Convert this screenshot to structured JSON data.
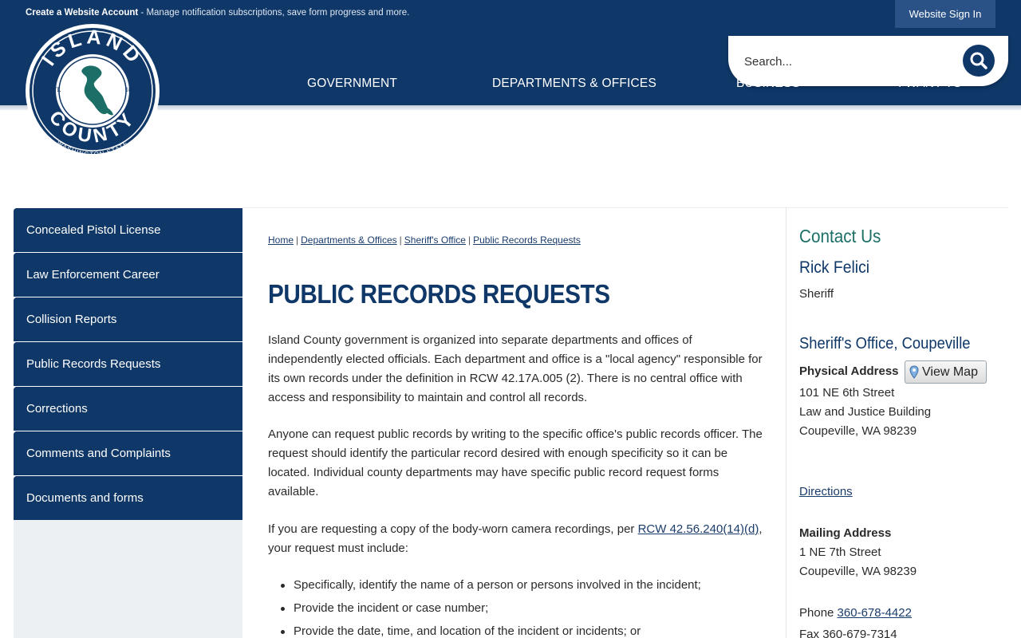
{
  "topbar": {
    "account_link": "Create a Website Account",
    "account_desc": " - Manage notification subscriptions, save form progress and more.",
    "signin_label": "Website Sign In"
  },
  "search": {
    "placeholder": "Search..."
  },
  "nav": {
    "items": [
      {
        "label": "GOVERNMENT"
      },
      {
        "label": "DEPARTMENTS & OFFICES"
      },
      {
        "label": "BUSINESS"
      },
      {
        "label": "I WANT TO"
      }
    ]
  },
  "logo": {
    "line1": "ISLAND",
    "line2": "COUNTY",
    "est": "EST.",
    "year": "1853",
    "state": "WASHINGTON STATE"
  },
  "sidebar": {
    "items": [
      {
        "label": "Concealed Pistol License"
      },
      {
        "label": "Law Enforcement Career"
      },
      {
        "label": "Collision Reports"
      },
      {
        "label": "Public Records Requests"
      },
      {
        "label": "Corrections"
      },
      {
        "label": "Comments and Complaints"
      },
      {
        "label": "Documents and forms"
      }
    ]
  },
  "breadcrumb": {
    "items": [
      {
        "label": "Home"
      },
      {
        "label": "Departments & Offices"
      },
      {
        "label": "Sheriff's Office"
      },
      {
        "label": "Public Records Requests"
      }
    ],
    "separator": "|"
  },
  "page": {
    "title": "PUBLIC RECORDS REQUESTS",
    "para1": "Island County government is organized into separate departments and offices of independently elected officials. Each department and office is a \"local agency\" responsible for its own records under the definition in RCW 42.17A.005 (2). There is no central office with access and responsibility to maintain and control all records.",
    "para2": "Anyone can request public records by writing to the specific office's public records officer. The request should identify the particular record desired with enough specificity so it can be located. Individual county departments may have specific public record request forms available.",
    "para3_before": "If you are requesting a copy of the body-worn camera recordings, per ",
    "para3_link": "RCW 42.56.240(14)(d)",
    "para3_after": ", your request must include:",
    "bullets": [
      "Specifically, identify the name of a person or persons involved in the incident;",
      "Provide the incident or case number;",
      "Provide the date, time, and location of the incident or incidents; or"
    ]
  },
  "contact": {
    "heading": "Contact Us",
    "name": "Rick Felici",
    "title": "Sheriff",
    "office": "Sheriff's Office, Coupeville",
    "physical_label": "Physical Address",
    "map_button": "View Map",
    "physical_lines": [
      "101 NE 6th Street",
      "Law and Justice Building",
      "Coupeville, WA 98239"
    ],
    "directions": "Directions",
    "mailing_label": "Mailing Address",
    "mailing_lines": [
      "1 NE 7th Street",
      "Coupeville, WA 98239"
    ],
    "phone_label": "Phone ",
    "phone": "360-678-4422",
    "fax_label": "Fax ",
    "fax": "360-679-7314"
  },
  "colors": {
    "brand_navy": "#0f3768",
    "accent_green": "#1c6f66",
    "link": "#1a3c6b"
  }
}
